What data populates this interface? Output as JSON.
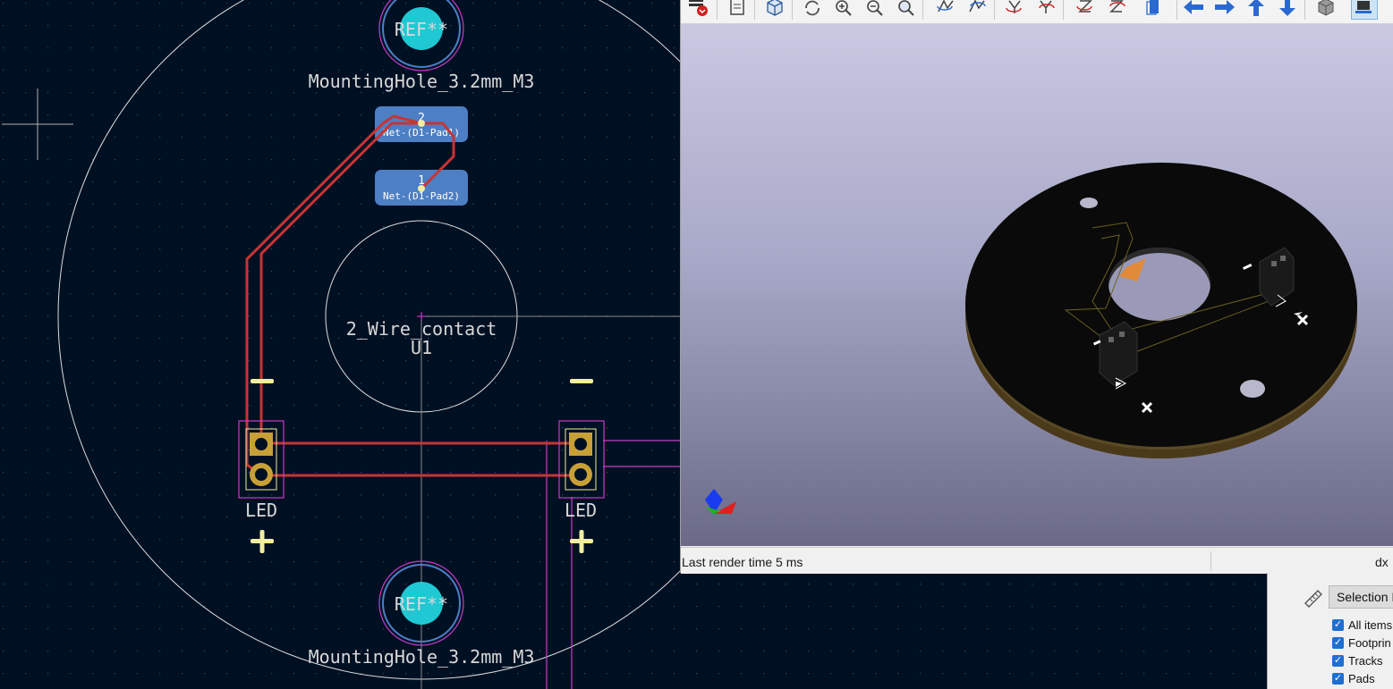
{
  "pcb": {
    "mounting_hole_top": {
      "ref": "REF**",
      "value": "MountingHole_3.2mm_M3"
    },
    "mounting_hole_bottom": {
      "ref": "REF**",
      "value": "MountingHole_3.2mm_M3"
    },
    "connector": {
      "pad2": {
        "number": "2",
        "net": "Net-(D1-Pad1)"
      },
      "pad1": {
        "number": "1",
        "net": "Net-(D1-Pad2)"
      }
    },
    "contact": {
      "value": "2_Wire_contact",
      "ref": "U1"
    },
    "led_left": {
      "label": "LED",
      "minus": "−",
      "plus": "+"
    },
    "led_right": {
      "label": "LED",
      "minus": "−",
      "plus": "+"
    }
  },
  "viewer3d": {
    "toolbar_icons": [
      "render-raytrace-icon",
      "copy-image-icon",
      "board-3d-icon",
      "reload-icon",
      "zoom-in-icon",
      "zoom-out-icon",
      "zoom-fit-icon",
      "rotate-x-cw-icon",
      "rotate-x-ccw-icon",
      "rotate-y-cw-icon",
      "rotate-y-ccw-icon",
      "rotate-z-cw-icon",
      "rotate-z-ccw-icon",
      "flip-board-icon",
      "move-left-icon",
      "move-right-icon",
      "move-up-icon",
      "move-down-icon",
      "ortho-view-icon",
      "layers-icon"
    ],
    "status": {
      "text": "Last render time 5 ms",
      "right": "dx"
    }
  },
  "selection_filter": {
    "title": "Selection F",
    "items": [
      {
        "label": "All items",
        "checked": true
      },
      {
        "label": "Footprin",
        "checked": true
      },
      {
        "label": "Tracks",
        "checked": true
      },
      {
        "label": "Pads",
        "checked": true
      }
    ]
  },
  "colors": {
    "background": "#001023",
    "track": "#c83434",
    "pad_gold": "#c8a038",
    "hole_cyan": "#1fc8d2",
    "courtyard": "#c83cc8",
    "silkscreen": "#f2eda1",
    "pad_blue": "#4d7fc4"
  }
}
